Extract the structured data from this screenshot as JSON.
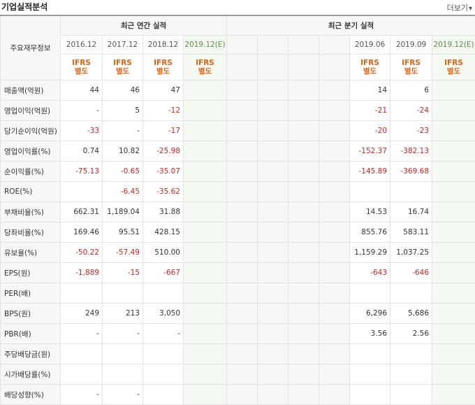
{
  "header": {
    "title": "기업실적분석",
    "more_label": "더보기",
    "more_icon": "chevron-down-icon"
  },
  "table": {
    "row_header": "주요재무정보",
    "annual_group": "최근 연간 실적",
    "quarter_group": "최근 분기 실적",
    "annual_periods": [
      "2016.12",
      "2017.12",
      "2018.12",
      "2019.12(E)"
    ],
    "quarter_periods": [
      "",
      "",
      "",
      "",
      "2019.06",
      "2019.09",
      "2019.12(E)"
    ],
    "ifrs_annual": [
      [
        "IFRS",
        "별도"
      ],
      [
        "IFRS",
        "별도"
      ],
      [
        "IFRS",
        "별도"
      ],
      [
        "IFRS",
        "별도"
      ]
    ],
    "ifrs_quarter": [
      [
        "",
        ""
      ],
      [
        "",
        ""
      ],
      [
        "",
        ""
      ],
      [
        "",
        ""
      ],
      [
        "IFRS",
        "별도"
      ],
      [
        "IFRS",
        "별도"
      ],
      [
        "IFRS",
        "별도"
      ]
    ],
    "rows": [
      {
        "label": "매출액(억원)",
        "annual": [
          "44",
          "46",
          "47",
          ""
        ],
        "quarter": [
          "",
          "",
          "",
          "",
          "14",
          "6",
          ""
        ]
      },
      {
        "label": "영업이익(억원)",
        "annual": [
          "-",
          "5",
          "-12",
          ""
        ],
        "quarter": [
          "",
          "",
          "",
          "",
          "-21",
          "-24",
          ""
        ]
      },
      {
        "label": "당기순이익(억원)",
        "annual": [
          "-33",
          "-",
          "-17",
          ""
        ],
        "quarter": [
          "",
          "",
          "",
          "",
          "-20",
          "-23",
          ""
        ]
      },
      {
        "label": "영업이익률(%)",
        "annual": [
          "0.74",
          "10.82",
          "-25.98",
          ""
        ],
        "quarter": [
          "",
          "",
          "",
          "",
          "-152.37",
          "-382.13",
          ""
        ]
      },
      {
        "label": "순이익률(%)",
        "annual": [
          "-75.13",
          "-0.65",
          "-35.07",
          ""
        ],
        "quarter": [
          "",
          "",
          "",
          "",
          "-145.89",
          "-369.68",
          ""
        ]
      },
      {
        "label": "ROE(%)",
        "annual": [
          "",
          "-6.45",
          "-35.62",
          ""
        ],
        "quarter": [
          "",
          "",
          "",
          "",
          "",
          "",
          ""
        ]
      },
      {
        "label": "부채비율(%)",
        "annual": [
          "662.31",
          "1,189.04",
          "31.88",
          ""
        ],
        "quarter": [
          "",
          "",
          "",
          "",
          "14.53",
          "16.74",
          ""
        ]
      },
      {
        "label": "당좌비율(%)",
        "annual": [
          "169.46",
          "95.51",
          "428.15",
          ""
        ],
        "quarter": [
          "",
          "",
          "",
          "",
          "855.76",
          "583.11",
          ""
        ]
      },
      {
        "label": "유보율(%)",
        "annual": [
          "-50.22",
          "-57.49",
          "510.00",
          ""
        ],
        "quarter": [
          "",
          "",
          "",
          "",
          "1,159.29",
          "1,037.25",
          ""
        ]
      },
      {
        "label": "EPS(원)",
        "annual": [
          "-1,889",
          "-15",
          "-667",
          ""
        ],
        "quarter": [
          "",
          "",
          "",
          "",
          "-643",
          "-646",
          ""
        ]
      },
      {
        "label": "PER(배)",
        "annual": [
          "",
          "",
          "",
          ""
        ],
        "quarter": [
          "",
          "",
          "",
          "",
          "",
          "",
          ""
        ]
      },
      {
        "label": "BPS(원)",
        "annual": [
          "249",
          "213",
          "3,050",
          ""
        ],
        "quarter": [
          "",
          "",
          "",
          "",
          "6,296",
          "5,686",
          ""
        ]
      },
      {
        "label": "PBR(배)",
        "annual": [
          "-",
          "-",
          "-",
          ""
        ],
        "quarter": [
          "",
          "",
          "",
          "",
          "3.56",
          "2.56",
          ""
        ]
      },
      {
        "label": "주당배당금(원)",
        "annual": [
          "",
          "",
          "",
          ""
        ],
        "quarter": [
          "",
          "",
          "",
          "",
          "",
          "",
          ""
        ]
      },
      {
        "label": "시가배당률(%)",
        "annual": [
          "",
          "",
          "",
          ""
        ],
        "quarter": [
          "",
          "",
          "",
          "",
          "",
          "",
          ""
        ]
      },
      {
        "label": "배당성향(%)",
        "annual": [
          "-",
          "-",
          "",
          ""
        ],
        "quarter": [
          "",
          "",
          "",
          "",
          "",
          "",
          ""
        ]
      }
    ],
    "separator_before_rows": [
      3,
      6,
      9,
      13
    ]
  },
  "colors": {
    "negative": "#cc2222",
    "ifrs": "#e06414",
    "estimate_bg": "#f4faf2"
  }
}
